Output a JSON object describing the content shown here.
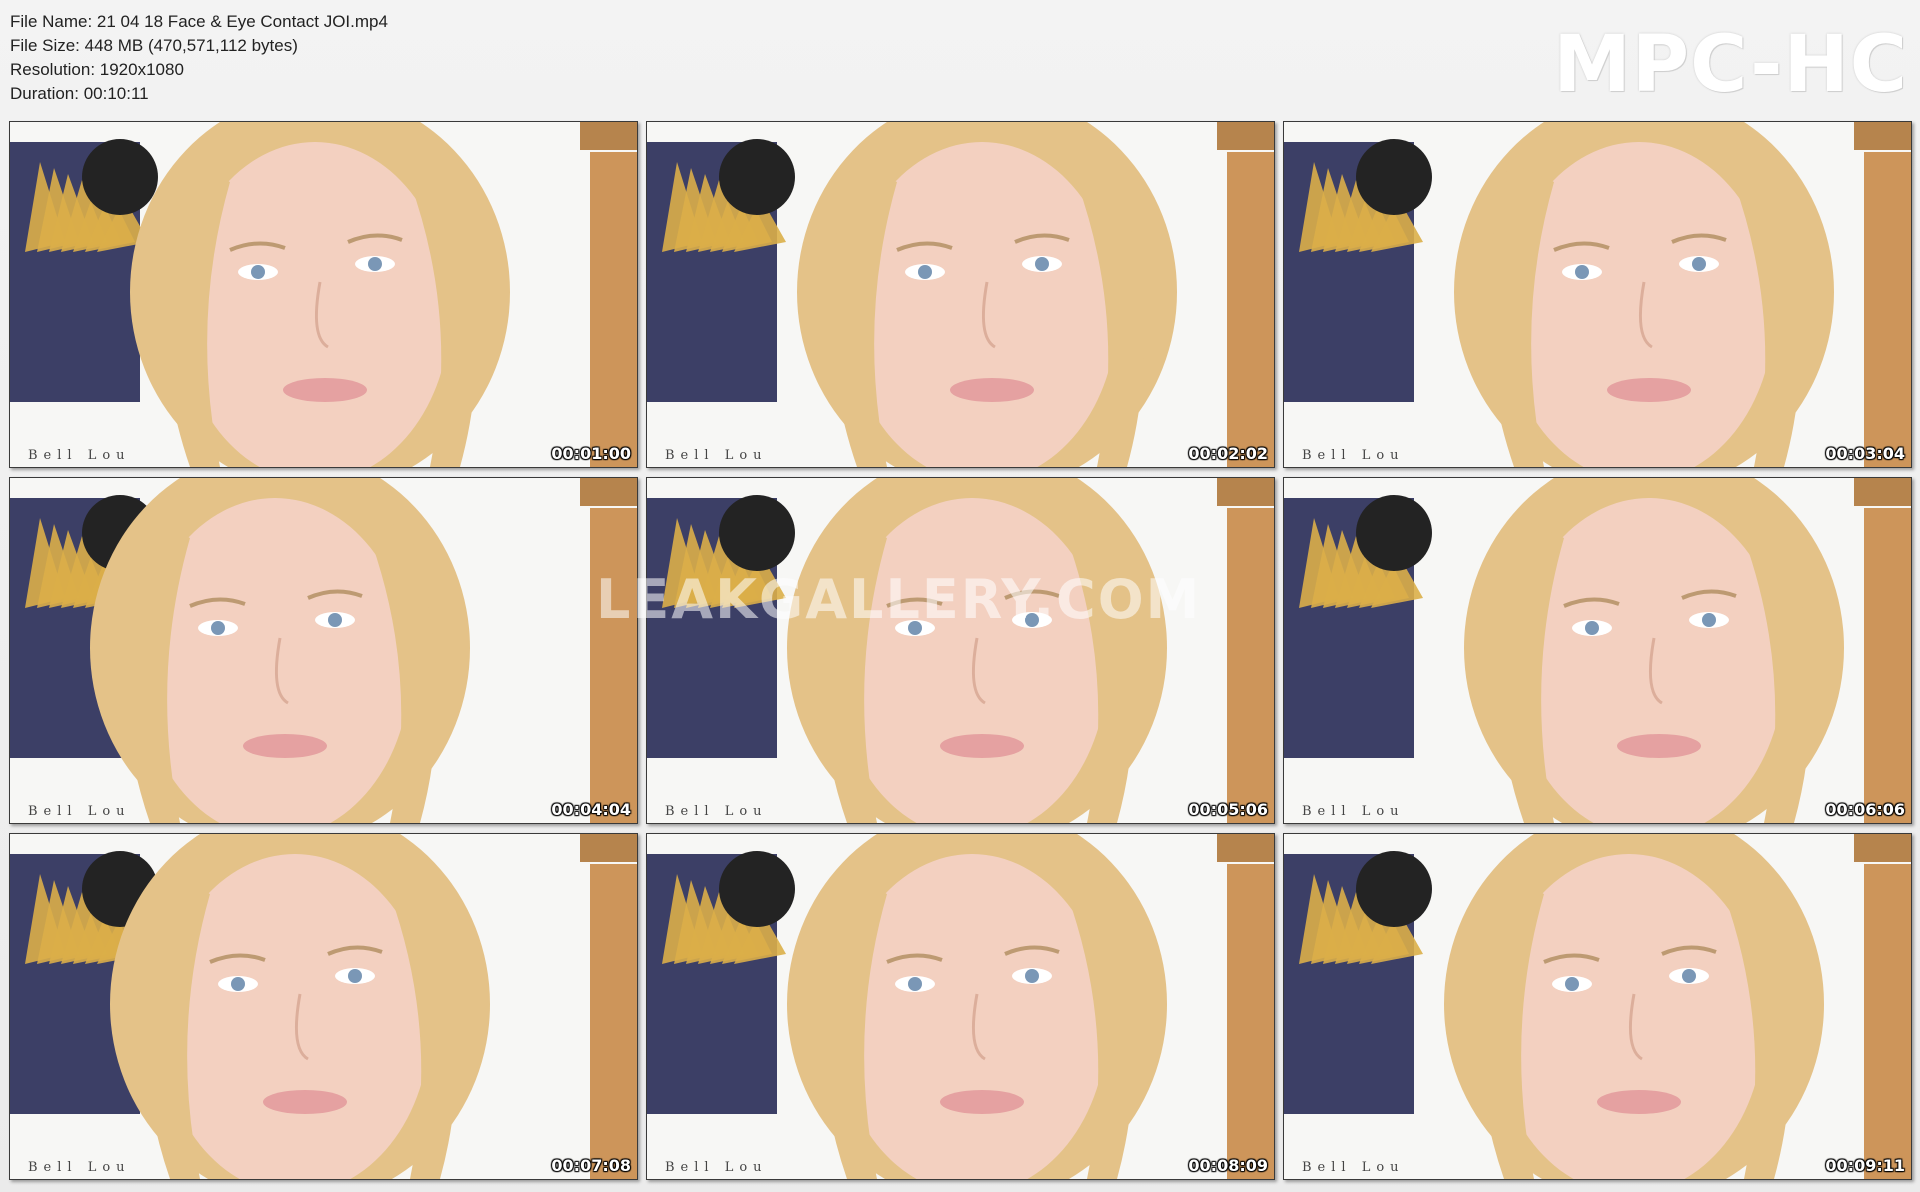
{
  "file_info": {
    "file_name": "File Name: 21 04 18 Face & Eye Contact JOI.mp4",
    "file_size": "File Size: 448 MB (470,571,112 bytes)",
    "resolution": "Resolution: 1920x1080",
    "duration": "Duration: 00:10:11"
  },
  "logo_text": "MPC-HC",
  "watermark_text": "LEAKGALLERY.COM",
  "brand_text": "Bell Lou",
  "colors": {
    "background": "#f0f0f0",
    "skin": "#f2cdbb",
    "hair": "#e2bd7e",
    "wall": "#f7f7f5",
    "tapestry": "#2c2f5a",
    "sun": "#d8a83a",
    "door": "#c98c4c"
  },
  "thumbnails": [
    {
      "timestamp": "00:01:00"
    },
    {
      "timestamp": "00:02:02"
    },
    {
      "timestamp": "00:03:04"
    },
    {
      "timestamp": "00:04:04"
    },
    {
      "timestamp": "00:05:06"
    },
    {
      "timestamp": "00:06:06"
    },
    {
      "timestamp": "00:07:08"
    },
    {
      "timestamp": "00:08:09"
    },
    {
      "timestamp": "00:09:11"
    }
  ]
}
